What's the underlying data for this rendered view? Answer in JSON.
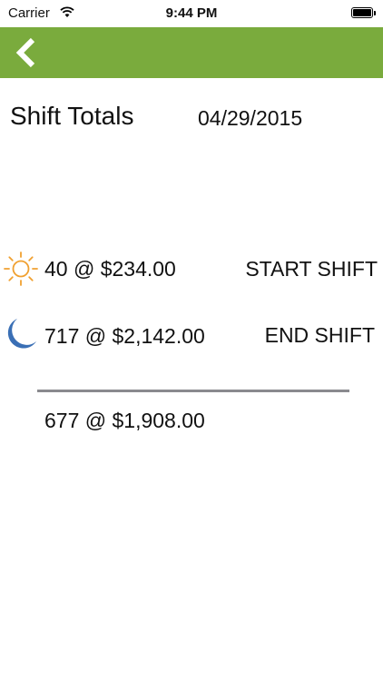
{
  "status_bar": {
    "carrier": "Carrier",
    "time": "9:44 PM"
  },
  "nav": {
    "background_color": "#7aab3d",
    "back_icon": "chevron-left-icon"
  },
  "header": {
    "title": "Shift Totals",
    "date": "04/29/2015"
  },
  "start_shift": {
    "icon": "sun-icon",
    "icon_color": "#f0a030",
    "value": "40 @ $234.00",
    "button_label": "START SHIFT"
  },
  "end_shift": {
    "icon": "moon-icon",
    "icon_color": "#3a6fb5",
    "value": "717 @ $2,142.00",
    "button_label": "END SHIFT"
  },
  "total": {
    "value": "677 @ $1,908.00"
  }
}
